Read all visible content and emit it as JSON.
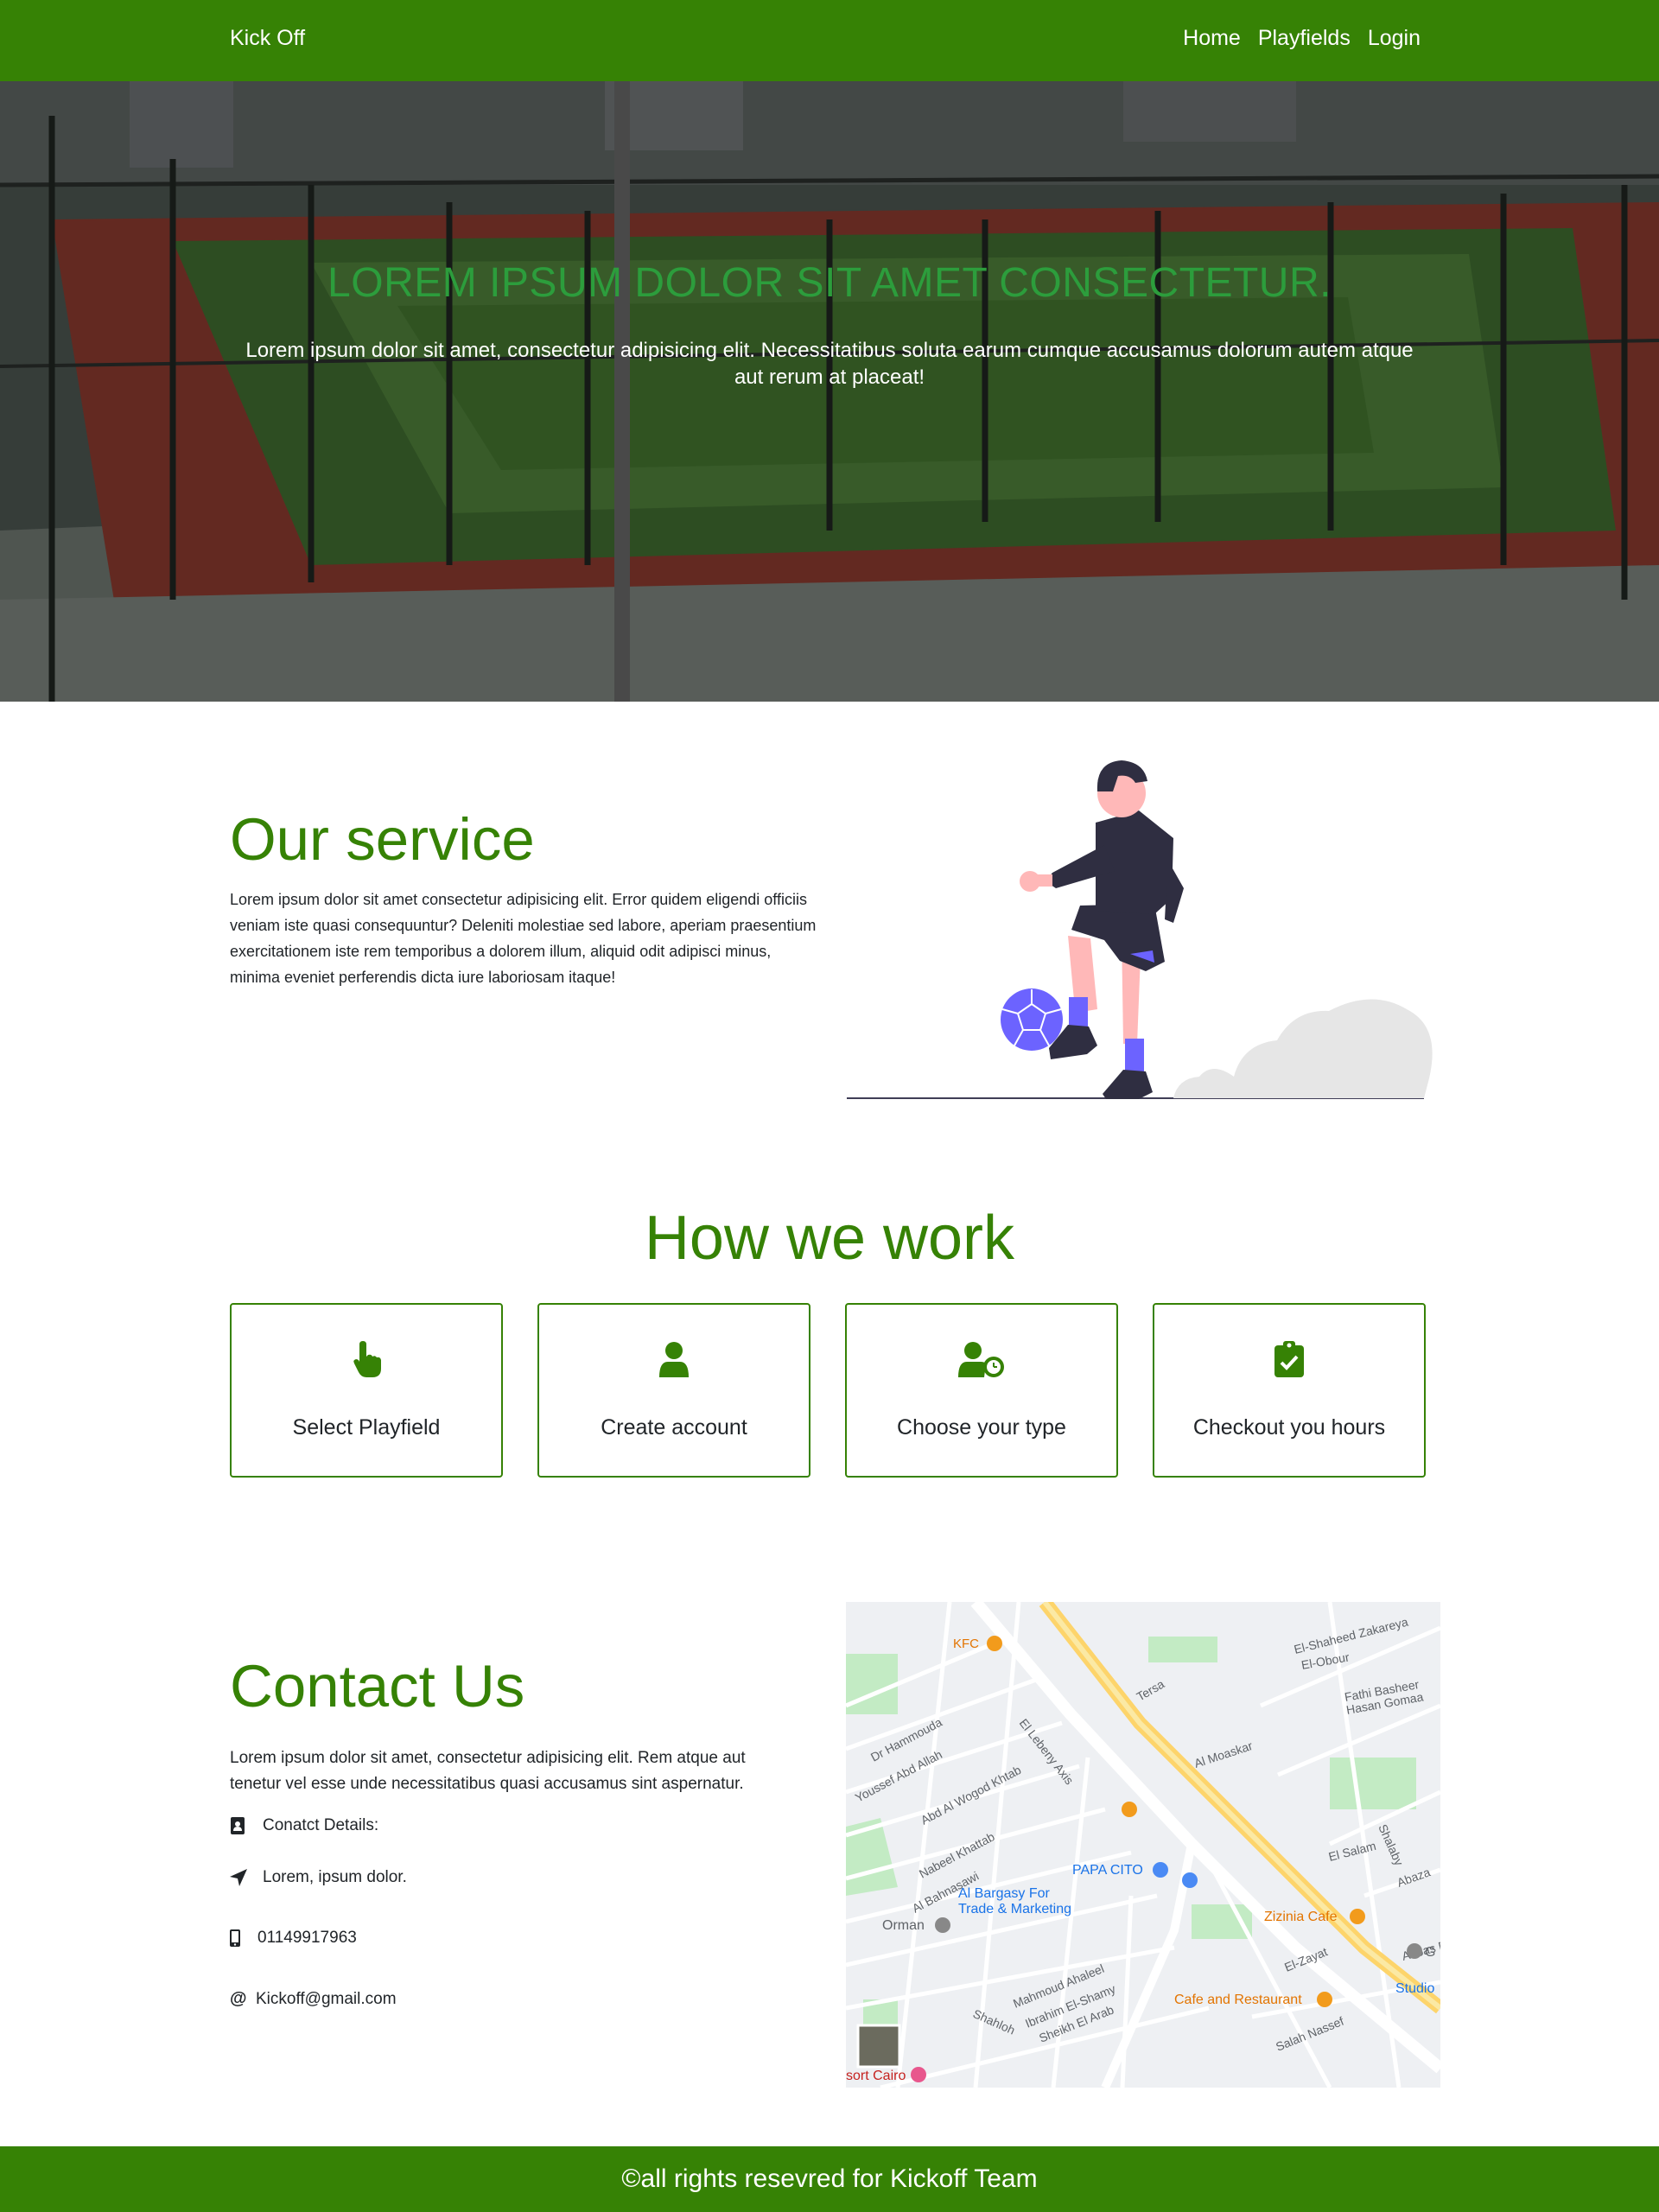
{
  "nav": {
    "brand": "Kick Off",
    "links": [
      "Home",
      "Playfields",
      "Login"
    ]
  },
  "hero": {
    "title": "LOREM IPSUM DOLOR SIT AMET CONSECTETUR.",
    "subtitle": "Lorem ipsum dolor sit amet, consectetur adipisicing elit. Necessitatibus soluta earum cumque accusamus dolorum autem atque aut rerum at placeat!"
  },
  "service": {
    "title": "Our service",
    "text": "Lorem ipsum dolor sit amet consectetur adipisicing elit. Error quidem eligendi officiis veniam iste quasi consequuntur? Deleniti molestiae sed labore, aperiam praesentium exercitationem iste rem temporibus a dolorem illum, aliquid odit adipisci minus, minima eveniet perferendis dicta iure laboriosam itaque!"
  },
  "how": {
    "title": "How we work",
    "cards": [
      {
        "label": "Select Playfield",
        "icon": "hand-pointer-icon"
      },
      {
        "label": "Create account",
        "icon": "user-icon"
      },
      {
        "label": "Choose your type",
        "icon": "user-clock-icon"
      },
      {
        "label": "Checkout you hours",
        "icon": "clipboard-check-icon"
      }
    ]
  },
  "contact": {
    "title": "Contact Us",
    "text": "Lorem ipsum dolor sit amet, consectetur adipisicing elit. Rem atque aut tenetur vel esse unde necessitatibus quasi accusamus sint aspernatur.",
    "details_label": "Conatct Details:",
    "address": "Lorem, ipsum dolor.",
    "phone": "01149917963",
    "email": "Kickoff@gmail.com"
  },
  "map": {
    "labels": [
      "KFC",
      "El Lebeny Axis",
      "Tersa",
      "Al Moaskar",
      "PAPA CITO",
      "Al Bargasy For Trade & Marketing",
      "Orman",
      "Zizinia Cafe",
      "Cafe and Restaurant",
      "Studio",
      "El Salam",
      "Hasan Gomaa",
      "Fathi Basheer",
      "El-Obour",
      "El-Shaheed Zakareya",
      "Abbas Riad",
      "El-Zayat",
      "Dr Hammouda",
      "Youssef Abd Allah",
      "Abd Al Wogod Khtab",
      "Nabeel Khattab",
      "Al Bahnasawi",
      "Shalaby",
      "Abaza",
      "Salah Nassef",
      "Mahmoud Ahaleel",
      "Ibrahim El-Shamy",
      "Sheikh El Arab",
      "Shahloh",
      "sort Cairo",
      "G"
    ]
  },
  "footer": {
    "text": "©all rights resevred for Kickoff Team"
  },
  "colors": {
    "brand": "#368205",
    "hero_title": "#2c9d3c"
  }
}
